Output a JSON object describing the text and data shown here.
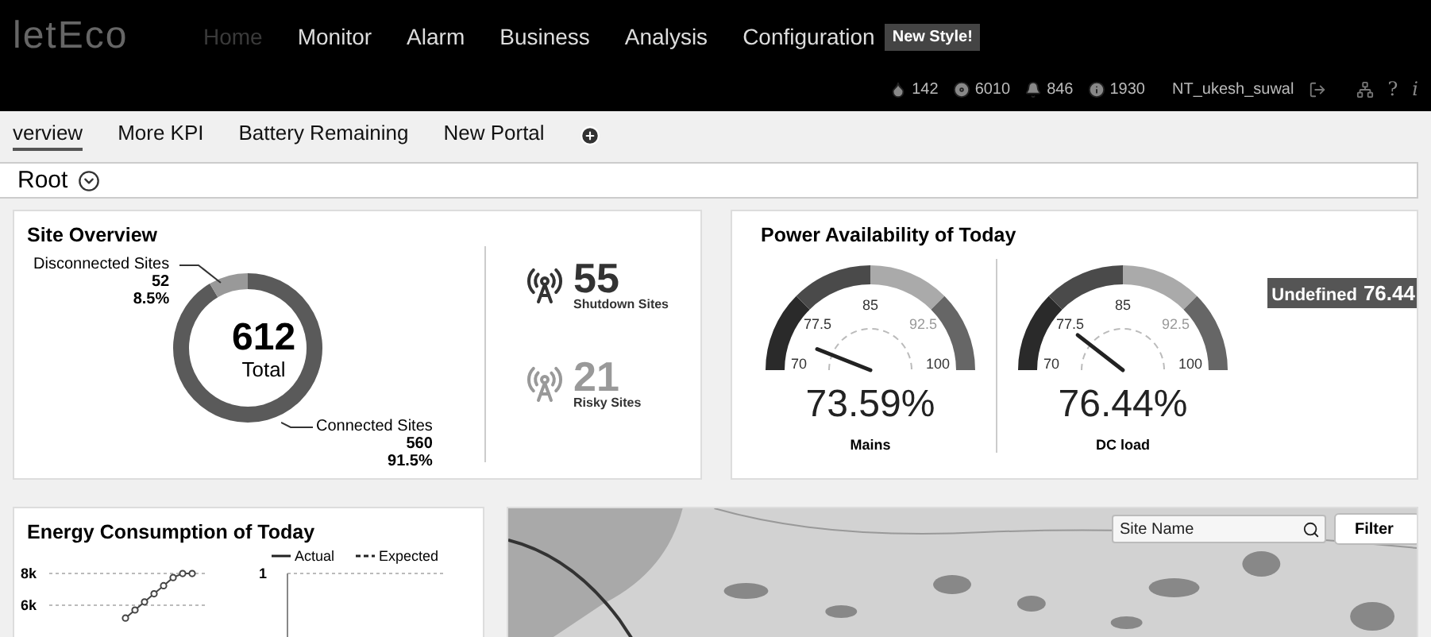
{
  "header": {
    "logo": "letEco",
    "nav": [
      {
        "label": "Home",
        "selected": true
      },
      {
        "label": "Monitor",
        "selected": false
      },
      {
        "label": "Alarm",
        "selected": false
      },
      {
        "label": "Business",
        "selected": false
      },
      {
        "label": "Analysis",
        "selected": false
      },
      {
        "label": "Configuration",
        "selected": false
      }
    ],
    "badge": "New Style!",
    "stats": [
      {
        "kind": "drop",
        "count": "142"
      },
      {
        "kind": "disc",
        "count": "6010"
      },
      {
        "kind": "bell",
        "count": "846"
      },
      {
        "kind": "info",
        "count": "1930"
      }
    ],
    "user": "NT_ukesh_suwal",
    "help": "?",
    "info": "i"
  },
  "tabs": [
    {
      "label": "verview",
      "selected": true
    },
    {
      "label": "More KPI",
      "selected": false
    },
    {
      "label": "Battery Remaining",
      "selected": false
    },
    {
      "label": "New Portal",
      "selected": false
    }
  ],
  "breadcrumb": "Root",
  "site_overview": {
    "title": "Site Overview",
    "total": "612",
    "total_label": "Total",
    "segments": [
      {
        "label": "Disconnected Sites",
        "count": "52",
        "percent": "8.5%"
      },
      {
        "label": "Connected Sites",
        "count": "560",
        "percent": "91.5%"
      }
    ],
    "stats": [
      {
        "kind": "shutdown",
        "value": "55",
        "label": "Shutdown Sites"
      },
      {
        "kind": "risky",
        "value": "21",
        "label": "Risky Sites"
      }
    ]
  },
  "power": {
    "title": "Power Availability of Today",
    "gauges": [
      {
        "value": "73.59%",
        "label": "Mains",
        "ticks": [
          "70",
          "77.5",
          "85",
          "92.5",
          "100"
        ]
      },
      {
        "value": "76.44%",
        "label": "DC load",
        "ticks": [
          "70",
          "77.5",
          "85",
          "92.5",
          "100"
        ]
      }
    ],
    "badge": {
      "label": "Undefined",
      "value": "76.44"
    }
  },
  "energy": {
    "title": "Energy Consumption of Today",
    "legend": [
      {
        "kind": "solid",
        "label": "Actual"
      },
      {
        "kind": "dashed",
        "label": "Expected"
      }
    ],
    "charts": [
      {
        "kind": "rising",
        "y_labels": [
          "8k",
          "6k"
        ]
      },
      {
        "kind": "empty",
        "y_labels": [
          "1"
        ]
      }
    ]
  },
  "map": {
    "kind": "picture",
    "search": {
      "placeholder": "Site Name"
    },
    "filter": "Filter"
  }
}
